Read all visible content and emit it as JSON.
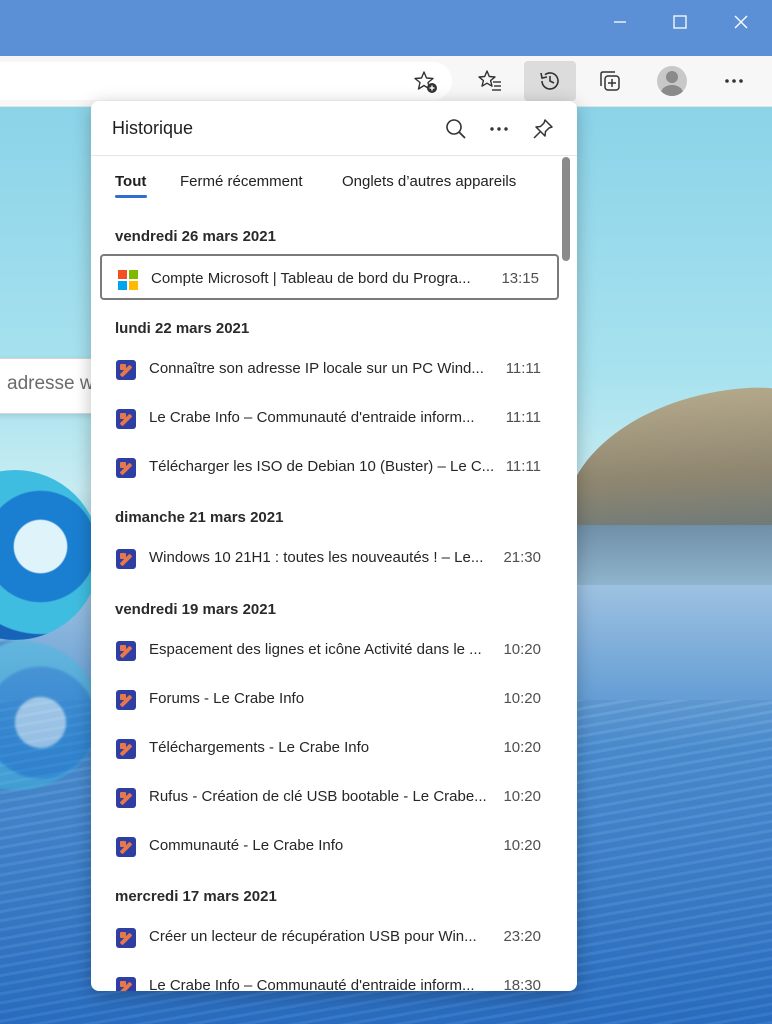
{
  "panel": {
    "title": "Historique",
    "tabs": [
      {
        "label": "Tout",
        "active": true
      },
      {
        "label": "Fermé récemment",
        "active": false
      },
      {
        "label": "Onglets d’autres appareils",
        "active": false
      }
    ],
    "groups": [
      {
        "date": "vendredi 26 mars 2021",
        "items": [
          {
            "title": "Compte Microsoft | Tableau de bord du Progra...",
            "time": "13:15",
            "favicon": "microsoft-icon",
            "selected": true
          }
        ]
      },
      {
        "date": "lundi 22 mars 2021",
        "items": [
          {
            "title": "Connaître son adresse IP locale sur un PC Wind...",
            "time": "11:11",
            "favicon": "le-crabe-info-icon"
          },
          {
            "title": "Le Crabe Info – Communauté d'entraide inform...",
            "time": "11:11",
            "favicon": "le-crabe-info-icon"
          },
          {
            "title": "Télécharger les ISO de Debian 10 (Buster) – Le C...",
            "time": "11:11",
            "favicon": "le-crabe-info-icon"
          }
        ]
      },
      {
        "date": "dimanche 21 mars 2021",
        "items": [
          {
            "title": "Windows 10 21H1 : toutes les nouveautés ! – Le...",
            "time": "21:30",
            "favicon": "le-crabe-info-icon"
          }
        ]
      },
      {
        "date": "vendredi 19 mars 2021",
        "items": [
          {
            "title": "Espacement des lignes et icône Activité dans le ...",
            "time": "10:20",
            "favicon": "le-crabe-info-icon"
          },
          {
            "title": "Forums - Le Crabe Info",
            "time": "10:20",
            "favicon": "le-crabe-info-icon"
          },
          {
            "title": "Téléchargements - Le Crabe Info",
            "time": "10:20",
            "favicon": "le-crabe-info-icon"
          },
          {
            "title": "Rufus - Création de clé USB bootable - Le Crabe...",
            "time": "10:20",
            "favicon": "le-crabe-info-icon"
          },
          {
            "title": "Communauté - Le Crabe Info",
            "time": "10:20",
            "favicon": "le-crabe-info-icon"
          }
        ]
      },
      {
        "date": "mercredi 17 mars 2021",
        "items": [
          {
            "title": "Créer un lecteur de récupération USB pour Win...",
            "time": "23:20",
            "favicon": "le-crabe-info-icon"
          },
          {
            "title": "Le Crabe Info – Communauté d'entraide inform...",
            "time": "18:30",
            "favicon": "le-crabe-info-icon"
          }
        ]
      }
    ]
  },
  "background": {
    "search_placeholder_fragment": "adresse w"
  },
  "colors": {
    "accent": "#2e6fcf",
    "titlebar": "#5b8fd6",
    "crabe_favicon": "#2f3ea3",
    "ms_red": "#f25022",
    "ms_green": "#7fba00",
    "ms_blue": "#00a4ef",
    "ms_yellow": "#ffb900"
  }
}
